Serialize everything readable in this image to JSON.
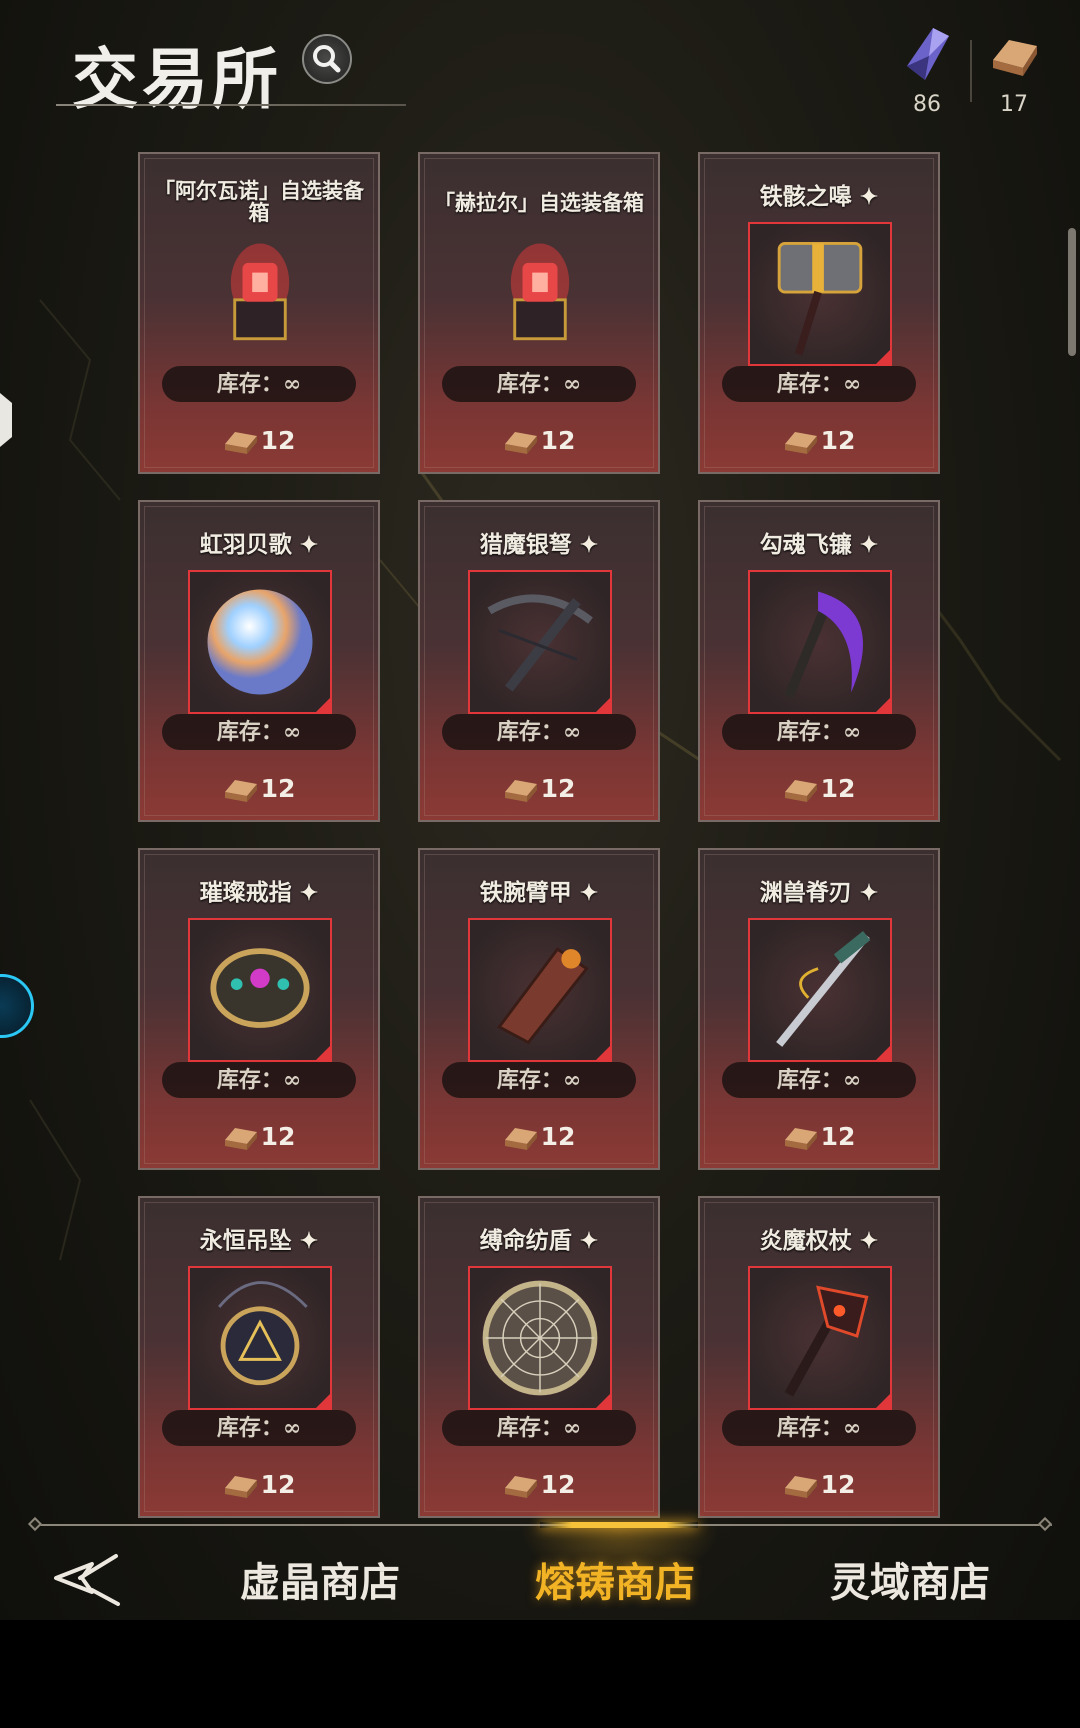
{
  "header": {
    "title": "交易所"
  },
  "currencies": [
    {
      "icon": "crystal-icon",
      "value": "86"
    },
    {
      "icon": "ingot-icon",
      "value": "17"
    }
  ],
  "colors": {
    "frame_red": "#e2373a",
    "active_tab": "#f2b325",
    "card_bottom": "#8b3a35"
  },
  "items": [
    {
      "name": "「阿尔瓦诺」自选装备箱",
      "star": false,
      "framed": false,
      "icon": "red-chest-icon",
      "stock_label": "库存：∞",
      "price": "12"
    },
    {
      "name": "「赫拉尔」自选装备箱",
      "star": false,
      "framed": false,
      "icon": "red-chest-icon",
      "stock_label": "库存：∞",
      "price": "12"
    },
    {
      "name": "铁骸之嗥",
      "star": true,
      "framed": true,
      "icon": "war-hammer-icon",
      "stock_label": "库存：∞",
      "price": "12"
    },
    {
      "name": "虹羽贝歌",
      "star": true,
      "framed": true,
      "icon": "orb-icon",
      "stock_label": "库存：∞",
      "price": "12"
    },
    {
      "name": "猎魔银弩",
      "star": true,
      "framed": true,
      "icon": "crossbow-icon",
      "stock_label": "库存：∞",
      "price": "12"
    },
    {
      "name": "勾魂飞镰",
      "star": true,
      "framed": true,
      "icon": "scythe-icon",
      "stock_label": "库存：∞",
      "price": "12"
    },
    {
      "name": "璀璨戒指",
      "star": true,
      "framed": true,
      "icon": "ring-icon",
      "stock_label": "库存：∞",
      "price": "12"
    },
    {
      "name": "铁腕臂甲",
      "star": true,
      "framed": true,
      "icon": "bracer-icon",
      "stock_label": "库存：∞",
      "price": "12"
    },
    {
      "name": "渊兽脊刃",
      "star": true,
      "framed": true,
      "icon": "blade-icon",
      "stock_label": "库存：∞",
      "price": "12"
    },
    {
      "name": "永恒吊坠",
      "star": true,
      "framed": true,
      "icon": "pendant-icon",
      "stock_label": "库存：∞",
      "price": "12"
    },
    {
      "name": "缚命纺盾",
      "star": true,
      "framed": true,
      "icon": "web-shield-icon",
      "stock_label": "库存：∞",
      "price": "12"
    },
    {
      "name": "炎魔权杖",
      "star": true,
      "framed": true,
      "icon": "demon-scepter-icon",
      "stock_label": "库存：∞",
      "price": "12"
    }
  ],
  "bottom_nav": {
    "tabs": [
      {
        "label": "虚晶商店",
        "active": false
      },
      {
        "label": "熔铸商店",
        "active": true
      },
      {
        "label": "灵域商店",
        "active": false
      }
    ]
  }
}
